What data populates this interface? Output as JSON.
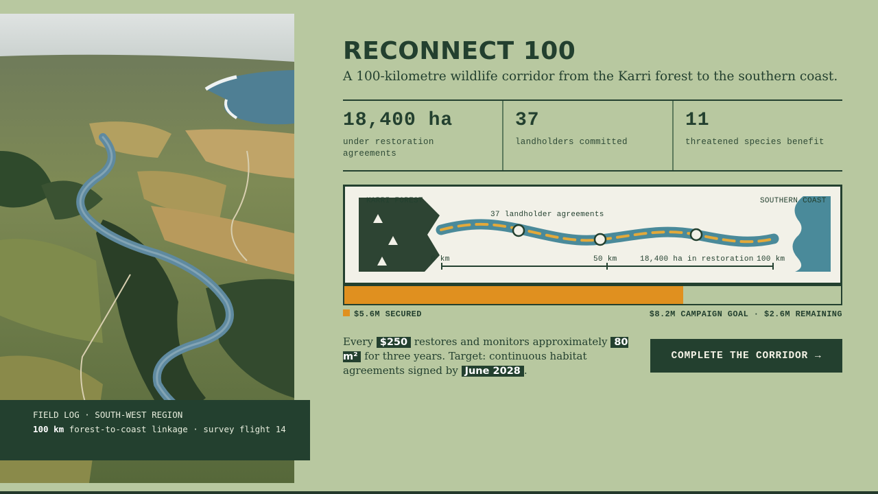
{
  "hero": {
    "title": "RECONNECT 100",
    "subtitle": "A 100-kilometre wildlife corridor from the Karri forest to the southern coast."
  },
  "stats": [
    {
      "value": "18,400 ha",
      "label": "under restoration agreements"
    },
    {
      "value": "37",
      "label": "landholders committed"
    },
    {
      "value": "11",
      "label": "threatened species benefit"
    }
  ],
  "corridor_map": {
    "start_label": "KARRI FOREST",
    "end_label": "SOUTHERN COAST",
    "agreements_label": "37 landholder agreements",
    "restoration_label": "18,400 ha in restoration",
    "scale": [
      "0 km",
      "50 km",
      "100 km"
    ]
  },
  "funding": {
    "secured_label": "$5.6M SECURED",
    "goal_label": "$8.2M CAMPAIGN GOAL · $2.6M REMAINING",
    "progress_fraction": 0.683,
    "accent_color": "#e0901f"
  },
  "pitch": {
    "prefix": "Every",
    "amount": "$250",
    "middle": "restores and monitors approximately",
    "area": "80 m²",
    "suffix": "for three years. Target: continuous habitat agreements signed by",
    "date": "June 2028",
    "end": "."
  },
  "cta": {
    "label": "COMPLETE THE CORRIDOR",
    "arrow": "→"
  },
  "caption": {
    "line1": "FIELD LOG · SOUTH-WEST REGION",
    "distance": "100 km",
    "line2_rest": "forest-to-coast linkage · survey flight 14"
  },
  "icons": {
    "tree": "triangle-tree-icon",
    "checkpoint": "circle-marker-icon",
    "arrow": "right-arrow-icon"
  },
  "colors": {
    "background": "#b8c8a0",
    "forest": "#23402f",
    "river": "#4a8a9a",
    "coast": "#4a8a9a"
  }
}
